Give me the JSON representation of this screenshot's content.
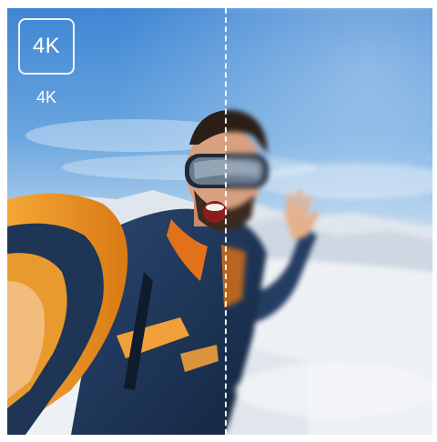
{
  "comparison": {
    "badge_label": "4K",
    "caption": "4K"
  },
  "colors": {
    "sky_top": "#3f86d3",
    "snow": "#eef1f4",
    "jacket_orange": "#e8901e",
    "jacket_navy": "#1e3556",
    "divider": "#ffffff"
  },
  "icons": {
    "badge": "4k-resolution-icon"
  }
}
